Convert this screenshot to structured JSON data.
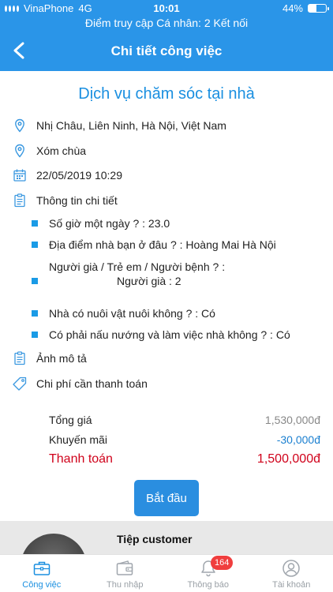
{
  "status_bar": {
    "carrier": "VinaPhone",
    "network": "4G",
    "time": "10:01",
    "battery": "44%",
    "battery_level": 0.44,
    "hotspot": "Điểm truy cập Cá nhân: 2 Kết nối"
  },
  "nav": {
    "title": "Chi tiết công việc",
    "back_icon": "chevron-left-icon"
  },
  "job": {
    "service": "Dịch vụ chăm sóc tại nhà",
    "address": "Nhị Châu, Liên Ninh, Hà Nội, Việt Nam",
    "address_detail": "Xóm chùa",
    "datetime": "22/05/2019 10:29",
    "details_heading": "Thông tin chi tiết",
    "details": [
      "Số giờ một ngày ? : 23.0",
      "Địa điểm nhà bạn ở đâu ? : Hoàng Mai Hà Nội",
      "Người già / Trẻ em / Người bệnh ? :",
      "Người già : 2",
      "Nhà có nuôi vật nuôi không ? : Có",
      "Có phải nấu nướng và làm việc nhà không ? : Có"
    ],
    "images_heading": "Ảnh mô tả",
    "cost_heading": "Chi phí cần thanh toán"
  },
  "pricing": {
    "total_label": "Tổng giá",
    "total_value": "1,530,000đ",
    "discount_label": "Khuyến mãi",
    "discount_value": "-30,000đ",
    "pay_label": "Thanh toán",
    "pay_value": "1,500,000đ"
  },
  "start_button": "Bắt đầu",
  "customer_card": {
    "title": "Tiệp customer"
  },
  "tabs": [
    {
      "label": "Công việc",
      "icon": "briefcase-icon",
      "active": true
    },
    {
      "label": "Thu nhập",
      "icon": "wallet-icon"
    },
    {
      "label": "Thông báo",
      "icon": "bell-icon",
      "badge": "164"
    },
    {
      "label": "Tài khoản",
      "icon": "user-icon"
    }
  ],
  "colors": {
    "primary": "#2a95e8",
    "accent_text": "#1a8fe0",
    "pay_red": "#d0021b",
    "badge_red": "#f03e3e"
  }
}
